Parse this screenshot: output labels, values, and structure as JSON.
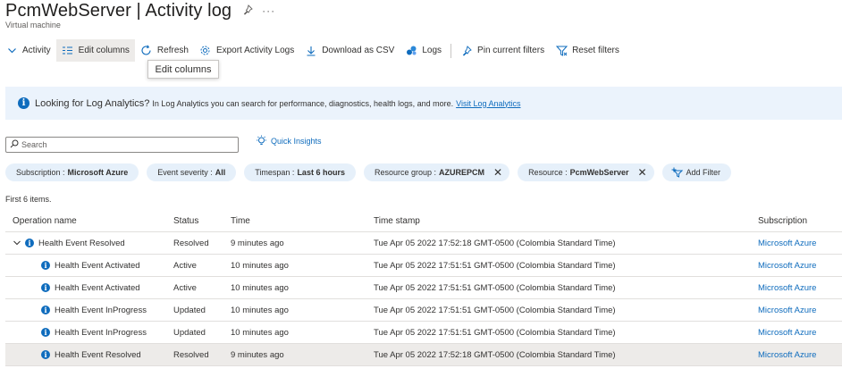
{
  "header": {
    "title": "PcmWebServer | Activity log",
    "subtitle": "Virtual machine",
    "more_label": "···"
  },
  "toolbar": {
    "activity": "Activity",
    "edit_columns": "Edit columns",
    "refresh": "Refresh",
    "export": "Export Activity Logs",
    "download": "Download as CSV",
    "logs": "Logs",
    "pin_filters": "Pin current filters",
    "reset_filters": "Reset filters"
  },
  "tooltip": "Edit columns",
  "info_banner": {
    "strong": "Looking for Log Analytics?",
    "text": "In Log Analytics you can search for performance, diagnostics, health logs, and more.",
    "link": "Visit Log Analytics"
  },
  "search": {
    "placeholder": "Search",
    "value": ""
  },
  "quick_insights": "Quick Insights",
  "filters": [
    {
      "key": "Subscription :",
      "value": "Microsoft Azure",
      "removable": false
    },
    {
      "key": "Event severity :",
      "value": "All",
      "removable": false
    },
    {
      "key": "Timespan :",
      "value": "Last 6 hours",
      "removable": false
    },
    {
      "key": "Resource group :",
      "value": "AZUREPCM",
      "removable": true
    },
    {
      "key": "Resource :",
      "value": "PcmWebServer",
      "removable": true
    }
  ],
  "add_filter": "Add Filter",
  "item_count": "First 6 items.",
  "table": {
    "columns": [
      "Operation name",
      "Status",
      "Time",
      "Time stamp",
      "Subscription"
    ],
    "rows": [
      {
        "operation": "Health Event Resolved",
        "status": "Resolved",
        "time": "9 minutes ago",
        "timestamp": "Tue Apr 05 2022 17:52:18 GMT-0500 (Colombia Standard Time)",
        "subscription": "Microsoft Azure"
      },
      {
        "operation": "Health Event Activated",
        "status": "Active",
        "time": "10 minutes ago",
        "timestamp": "Tue Apr 05 2022 17:51:51 GMT-0500 (Colombia Standard Time)",
        "subscription": "Microsoft Azure"
      },
      {
        "operation": "Health Event Activated",
        "status": "Active",
        "time": "10 minutes ago",
        "timestamp": "Tue Apr 05 2022 17:51:51 GMT-0500 (Colombia Standard Time)",
        "subscription": "Microsoft Azure"
      },
      {
        "operation": "Health Event InProgress",
        "status": "Updated",
        "time": "10 minutes ago",
        "timestamp": "Tue Apr 05 2022 17:51:51 GMT-0500 (Colombia Standard Time)",
        "subscription": "Microsoft Azure"
      },
      {
        "operation": "Health Event InProgress",
        "status": "Updated",
        "time": "10 minutes ago",
        "timestamp": "Tue Apr 05 2022 17:51:51 GMT-0500 (Colombia Standard Time)",
        "subscription": "Microsoft Azure"
      },
      {
        "operation": "Health Event Resolved",
        "status": "Resolved",
        "time": "9 minutes ago",
        "timestamp": "Tue Apr 05 2022 17:52:18 GMT-0500 (Colombia Standard Time)",
        "subscription": "Microsoft Azure"
      }
    ]
  },
  "colors": {
    "accent": "#0f6cbd",
    "pill_bg": "#e6f0fa",
    "banner_bg": "#ebf3fc",
    "selected_row": "#edebe9"
  }
}
